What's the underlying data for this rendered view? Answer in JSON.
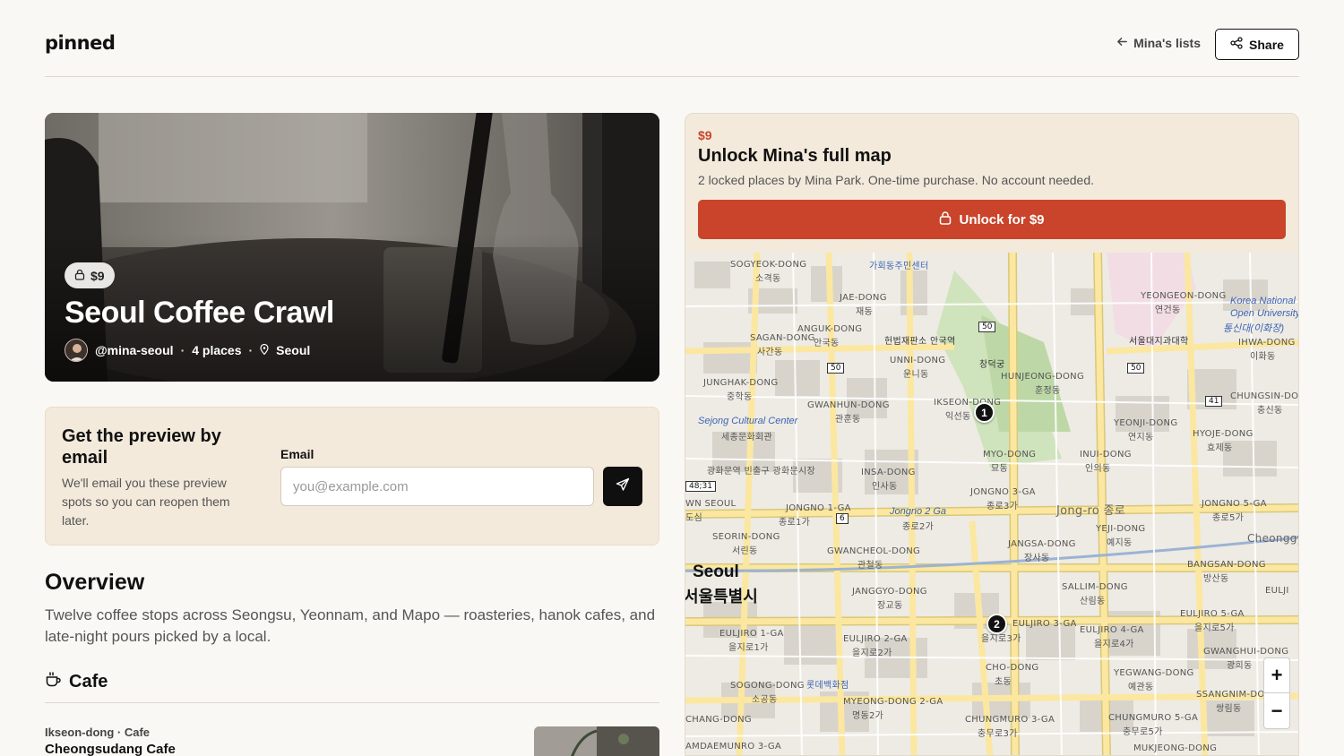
{
  "app": {
    "logo": "pinned"
  },
  "header": {
    "back_label": "Mina's lists",
    "share_label": "Share"
  },
  "hero": {
    "price_badge": "$9",
    "title": "Seoul Coffee Crawl",
    "handle": "@mina-seoul",
    "places": "4 places",
    "city": "Seoul"
  },
  "preview": {
    "title": "Get the preview by email",
    "description": "We'll email you these preview spots so you can reopen them later.",
    "email_label": "Email",
    "email_placeholder": "you@example.com",
    "email_value": ""
  },
  "overview": {
    "heading": "Overview",
    "text": "Twelve coffee stops across Seongsu, Yeonnam, and Mapo — roasteries, hanok cafes, and late-night pours picked by a local."
  },
  "section": {
    "heading": "Cafe"
  },
  "place": {
    "subtitle": "Ikseon-dong · Cafe",
    "name": "Cheongsudang Cafe"
  },
  "unlock": {
    "price": "$9",
    "title": "Unlock Mina's full map",
    "description": "2 locked places by Mina Park. One-time purchase. No account needed.",
    "button_label": "Unlock for $9"
  },
  "map": {
    "markers": [
      "1",
      "2"
    ],
    "zoom_in": "+",
    "zoom_out": "−",
    "city_en": "Seoul",
    "city_ko": "서울특별시",
    "labels": [
      "SOGYEOK-DONG",
      "소격동",
      "가회동주민센터",
      "JAE-DONG",
      "재동",
      "ANGUK-DONG",
      "안국동",
      "SAGAN-DONG",
      "사간동",
      "헌법재판소 안국역",
      "UNNI-DONG",
      "운니동",
      "창덕궁",
      "YEONGEON-DONG",
      "연건동",
      "서울대지과대학",
      "Korea National",
      "Open University",
      "통신대(이화장)",
      "IHWA-DONG",
      "이화동",
      "HUNJEONG-DONG",
      "훈정동",
      "JUNGHAK-DONG",
      "중학동",
      "GWANHUN-DONG",
      "관훈동",
      "IKSEON-DONG",
      "익선동",
      "CHUNGSIN-DONG",
      "충신동",
      "Sejong Cultural Center",
      "세종문화회관",
      "YEONJI-DONG",
      "연지동",
      "HYOJE-DONG",
      "효제동",
      "광화문역 빈출구 광화문시장",
      "MYO-DONG",
      "묘동",
      "INUI-DONG",
      "인의동",
      "INSA-DONG",
      "인사동",
      "JONGNO 3-GA",
      "종로3가",
      "JONGNO 5-GA",
      "종로5가",
      "WN SEOUL",
      "도심",
      "JONGNO 1-GA",
      "종로1가",
      "Jongno 2 Ga",
      "종로2가",
      "Jong-ro 종로",
      "YEJI-DONG",
      "예지동",
      "Cheonggy",
      "SEORIN-DONG",
      "서린동",
      "GWANCHEOL-DONG",
      "관철동",
      "JANGSA-DONG",
      "장사동",
      "BANGSAN-DONG",
      "방산동",
      "JANGGYO-DONG",
      "장교동",
      "SALLIM-DONG",
      "산림동",
      "EULJI",
      "EULJIRO 3-GA",
      "을지로3가",
      "EULJIRO 1-GA",
      "을지로1가",
      "EULJIRO 2-GA",
      "을지로2가",
      "EULJIRO 4-GA",
      "을지로4가",
      "EULJIRO 5-GA",
      "을지로5가",
      "SOGONG-DONG",
      "소공동",
      "롯데백화점",
      "CHO-DONG",
      "초동",
      "YEGWANG-DONG",
      "예관동",
      "GWANGHUI-DONG",
      "광희동",
      "MYEONG-DONG 2-GA",
      "명동2가",
      "CHUNGMURO 3-GA",
      "충무로3가",
      "SSANGNIM-DONG",
      "쌍림동",
      "CHANG-DONG",
      "CHUNGMURO 5-GA",
      "충무로5가",
      "MUKJEONG-DONG",
      "AMDAEMUNRO 3-GA"
    ],
    "road_numbers": [
      "50",
      "50",
      "50",
      "41",
      "6",
      "48;31"
    ]
  },
  "colors": {
    "accent": "#c9442a",
    "card": "#f3eadc",
    "background": "#faf8f4"
  }
}
